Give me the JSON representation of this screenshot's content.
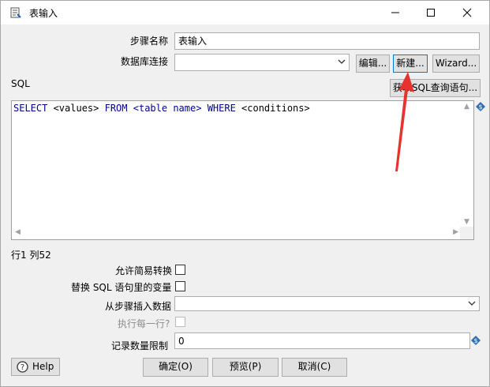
{
  "window": {
    "title": "表输入",
    "icon": "table-input-icon",
    "controls": {
      "minimize": "minimize-icon",
      "maximize": "maximize-icon",
      "close": "close-icon"
    }
  },
  "form": {
    "step_name_label": "步骤名称",
    "step_name_value": "表输入",
    "db_connection_label": "数据库连接",
    "db_connection_value": "",
    "edit_button": "编辑...",
    "new_button": "新建...",
    "wizard_button": "Wizard...",
    "sql_label": "SQL",
    "get_sql_button": "获取SQL查询语句...",
    "sql_text": {
      "kw1": "SELECT",
      "p1": " <values> ",
      "kw2": "FROM",
      "p2": " ",
      "tbl": "<table name>",
      "p3": " ",
      "kw3": "WHERE",
      "p4": " <conditions>"
    },
    "cursor_position": "行1 列52",
    "allow_lazy_conversion_label": "允许简易转换",
    "replace_variables_label": "替换 SQL 语句里的变量",
    "insert_data_from_step_label": "从步骤插入数据",
    "insert_data_from_step_value": "",
    "execute_each_row_label": "执行每一行?",
    "limit_size_label": "记录数量限制",
    "limit_size_value": "0"
  },
  "footer": {
    "help_button": "Help",
    "ok_button": "确定(O)",
    "preview_button": "预览(P)",
    "cancel_button": "取消(C)"
  },
  "colors": {
    "sql_keyword": "#00008b",
    "annotation_arrow": "#e8322f",
    "focus_border": "#0078d7"
  }
}
